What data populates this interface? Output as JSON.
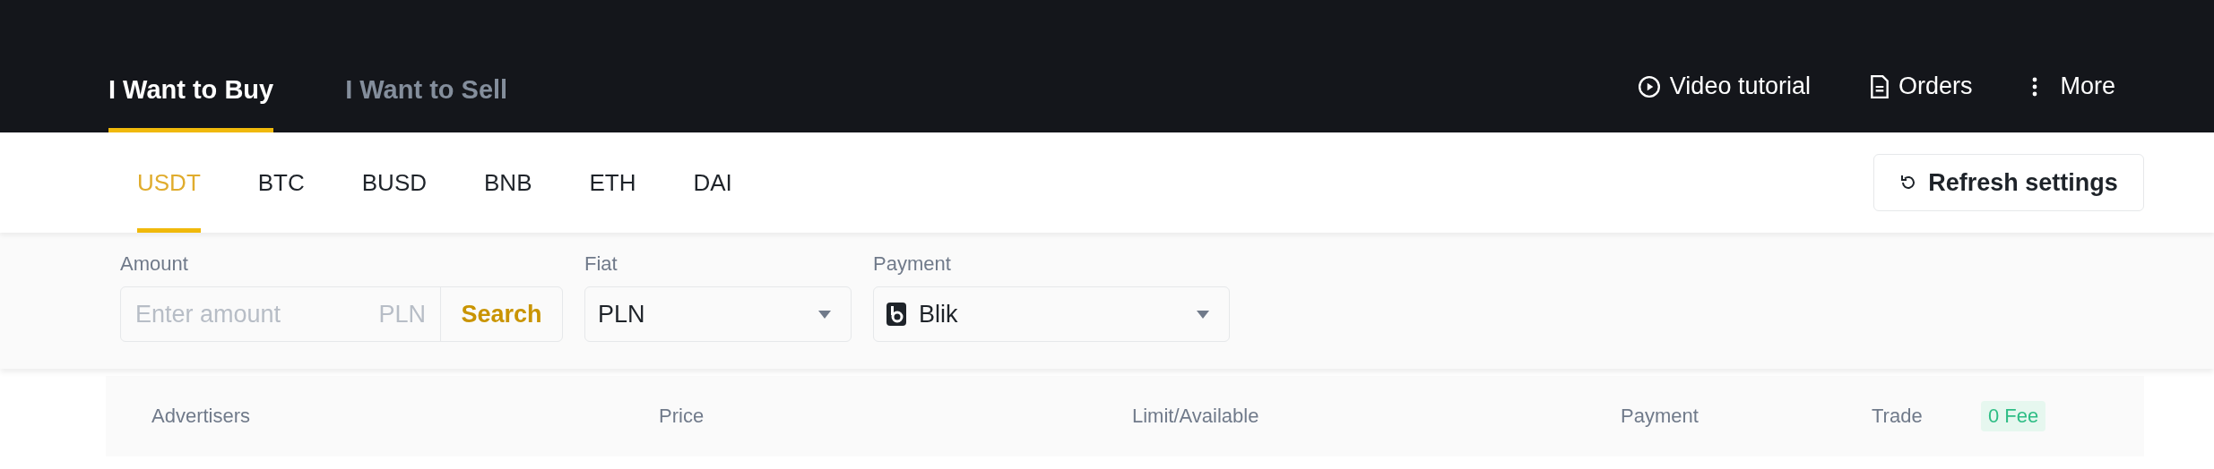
{
  "trade_tabs": [
    {
      "label": "I Want to Buy",
      "selected": true
    },
    {
      "label": "I Want to Sell",
      "selected": false
    }
  ],
  "header_links": [
    {
      "kind": "video",
      "label": "Video tutorial"
    },
    {
      "kind": "orders",
      "label": "Orders"
    },
    {
      "kind": "more",
      "label": "More"
    }
  ],
  "coin_tabs": [
    {
      "label": "USDT",
      "selected": true
    },
    {
      "label": "BTC",
      "selected": false
    },
    {
      "label": "BUSD",
      "selected": false
    },
    {
      "label": "BNB",
      "selected": false
    },
    {
      "label": "ETH",
      "selected": false
    },
    {
      "label": "DAI",
      "selected": false
    }
  ],
  "refresh_button": {
    "label": "Refresh settings"
  },
  "filters": {
    "amount": {
      "label": "Amount",
      "placeholder": "Enter amount",
      "currency": "PLN",
      "button": "Search"
    },
    "fiat": {
      "label": "Fiat",
      "value": "PLN"
    },
    "payment": {
      "label": "Payment",
      "value": "Blik"
    }
  },
  "table": {
    "columns": [
      "Advertisers",
      "Price",
      "Limit/Available",
      "Payment",
      "Trade"
    ],
    "fee_badge": "0 Fee"
  }
}
